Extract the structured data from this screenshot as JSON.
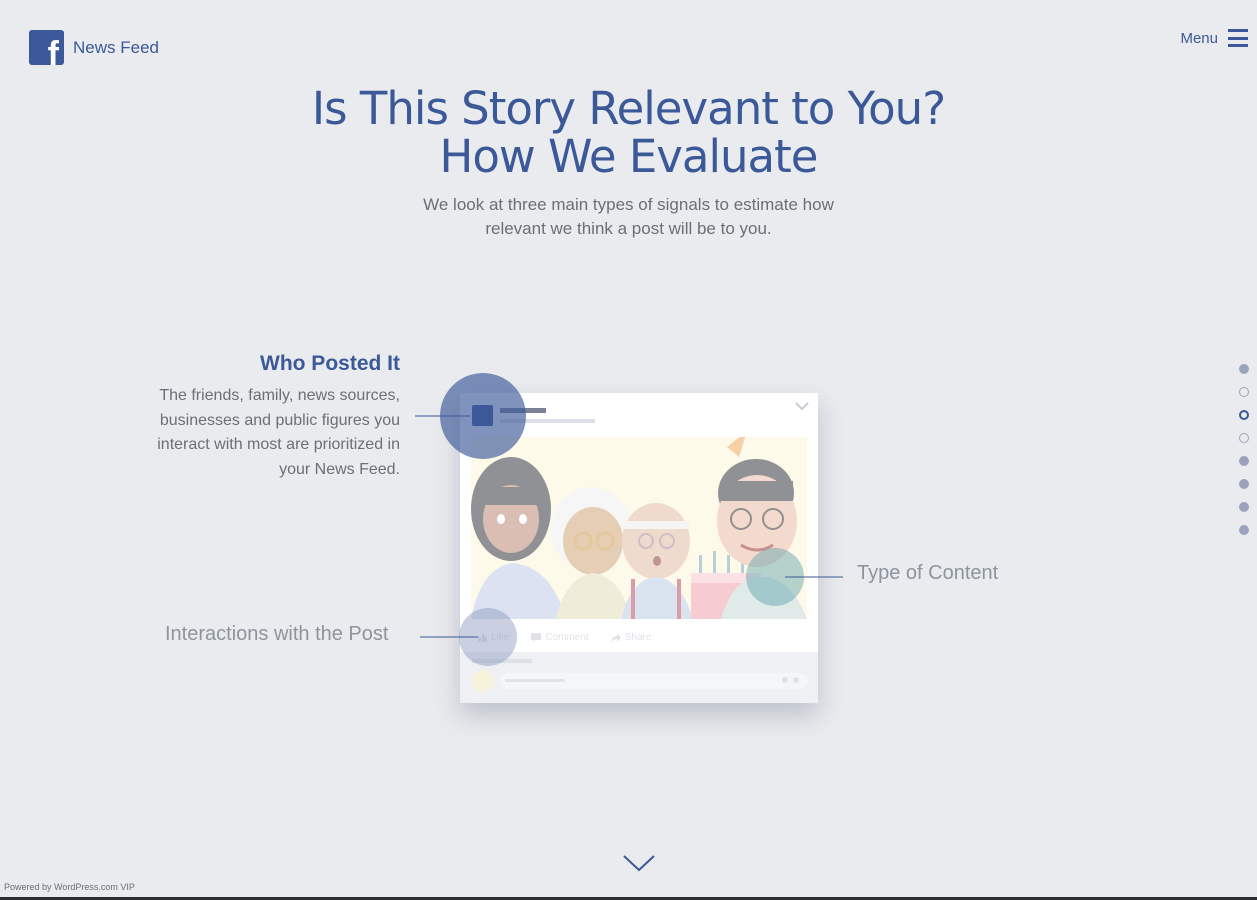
{
  "header": {
    "brand": "News Feed",
    "menu_label": "Menu"
  },
  "hero": {
    "title_line1": "Is This Story Relevant to You?",
    "title_line2": "How We Evaluate",
    "subtitle_line1": "We look at three main types of signals to estimate how",
    "subtitle_line2": "relevant we think a post will be to you."
  },
  "signals": {
    "who": {
      "heading": "Who Posted It",
      "text_lines": [
        "The friends, family, news sources,",
        "businesses and public figures you",
        "interact with most are prioritized in",
        "your News Feed."
      ]
    },
    "type_label": "Type of Content",
    "interactions_label": "Interactions with the Post"
  },
  "post": {
    "actions": [
      "Like",
      "Comment",
      "Share"
    ]
  },
  "pager": {
    "dots": [
      "filled",
      "hollow",
      "active",
      "hollow",
      "filled",
      "filled",
      "filled",
      "filled"
    ]
  },
  "footer": {
    "powered": "Powered by WordPress.com VIP"
  },
  "colors": {
    "brand": "#3b5998",
    "background": "#e9ebee",
    "highlight_circle": "#3b5998",
    "teal_circle": "#5a9fa8"
  },
  "icons": {
    "logo": "facebook-f-icon",
    "menu": "hamburger-icon",
    "scroll": "chevron-down-icon"
  }
}
